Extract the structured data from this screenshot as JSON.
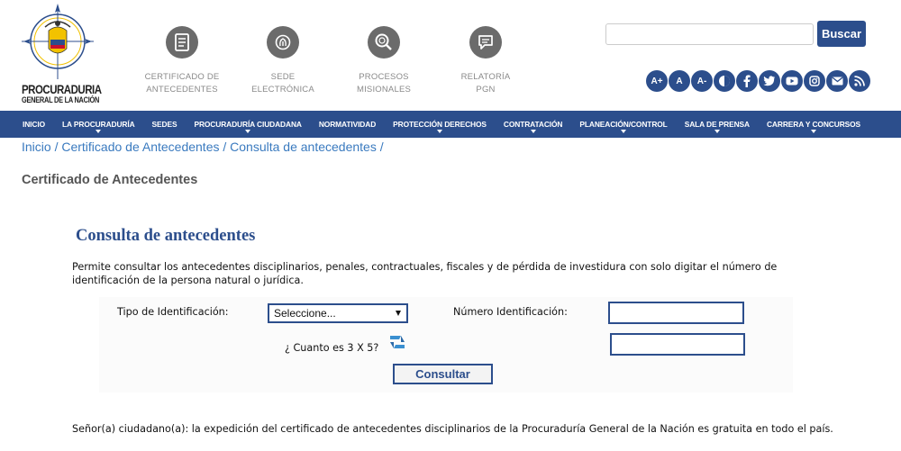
{
  "logo": {
    "line1": "PROCURADURIA",
    "line2": "GENERAL DE LA NACIÓN"
  },
  "top_links": [
    {
      "icon": "certificate-icon",
      "line1": "CERTIFICADO DE",
      "line2": "ANTECEDENTES"
    },
    {
      "icon": "fingerprint-icon",
      "line1": "SEDE",
      "line2": "ELECTRÓNICA"
    },
    {
      "icon": "search-doc-icon",
      "line1": "PROCESOS",
      "line2": "MISIONALES"
    },
    {
      "icon": "chat-icon",
      "line1": "RELATORÍA",
      "line2": "PGN"
    }
  ],
  "search": {
    "placeholder": "",
    "button_label": "Buscar"
  },
  "tools": [
    "A+",
    "A",
    "A-"
  ],
  "nav": [
    {
      "label": "INICIO",
      "has_dropdown": false
    },
    {
      "label": "LA PROCURADURÍA",
      "has_dropdown": true
    },
    {
      "label": "SEDES",
      "has_dropdown": false
    },
    {
      "label": "PROCURADURÍA CIUDADANA",
      "has_dropdown": true
    },
    {
      "label": "NORMATIVIDAD",
      "has_dropdown": false
    },
    {
      "label": "PROTECCIÓN DERECHOS",
      "has_dropdown": true
    },
    {
      "label": "CONTRATACIÓN",
      "has_dropdown": true
    },
    {
      "label": "PLANEACIÓN/CONTROL",
      "has_dropdown": true
    },
    {
      "label": "SALA DE PRENSA",
      "has_dropdown": true
    },
    {
      "label": "CARRERA Y CONCURSOS",
      "has_dropdown": true
    }
  ],
  "breadcrumb": [
    "Inicio",
    "Certificado de Antecedentes",
    "Consulta de antecedentes"
  ],
  "page_title": "Certificado de Antecedentes",
  "section_title": "Consulta de antecedentes",
  "description": "Permite consultar los antecedentes disciplinarios, penales, contractuales, fiscales y de pérdida de investidura con solo digitar el número de identificación de la persona natural o jurídica.",
  "form": {
    "id_type_label": "Tipo de Identificación:",
    "id_type_selected": "Seleccione...",
    "id_number_label": "Número Identificación:",
    "id_number_value": "",
    "captcha_question": "¿ Cuanto es 3 X 5?",
    "captcha_answer": "",
    "submit_label": "Consultar"
  },
  "footer_note": "Señor(a) ciudadano(a): la expedición del certificado de antecedentes disciplinarios de la Procuraduría General de la Nación es gratuita en todo el país.",
  "colors": {
    "brand": "#2c4e8c",
    "link": "#3a7abf",
    "icon_gray": "#6b6b6b"
  }
}
